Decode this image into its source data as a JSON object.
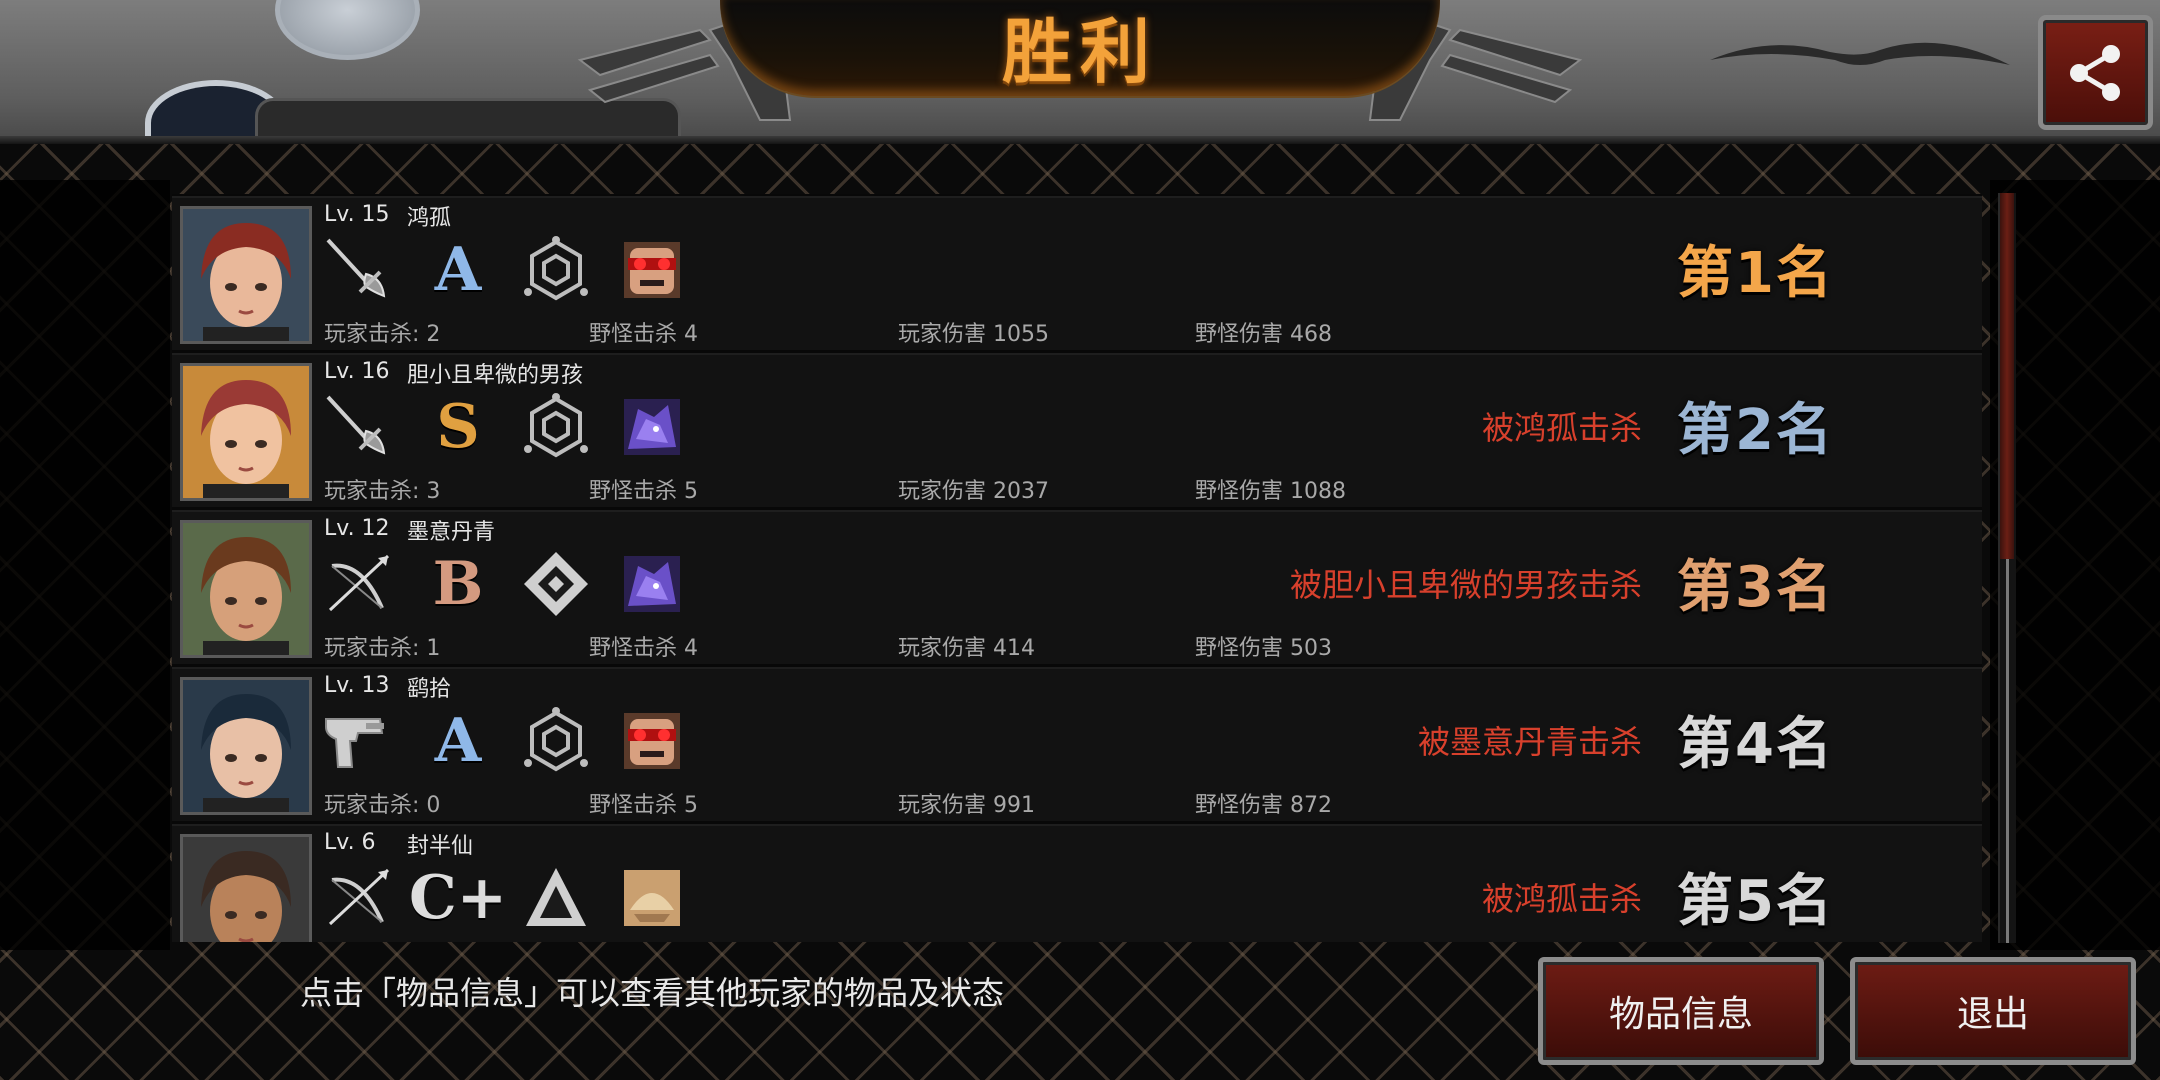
{
  "header": {
    "title": "胜利",
    "bg_color": "#6b6b6b",
    "title_color": "#f3a23a"
  },
  "rows": [
    {
      "level": "Lv. 15",
      "name": "鸿孤",
      "weapon_icon": "rapier-icon",
      "grade": "A",
      "grade_color": "#8fb8e8",
      "armor_icon": "hexagon-emblem-icon",
      "pet_icon": "red-goggles-face-icon",
      "player_kills": "玩家击杀: 2",
      "monster_kills": "野怪击杀 4",
      "player_damage": "玩家伤害 1055",
      "monster_damage": "野怪伤害 468",
      "killed_by": "",
      "rank": "第1名",
      "rank_color": "#f4a64a",
      "portrait_hair": "#8a2c22",
      "portrait_skin": "#e9b89a",
      "portrait_bg": "#3a4a5a"
    },
    {
      "level": "Lv. 16",
      "name": "胆小且卑微的男孩",
      "weapon_icon": "rapier-icon",
      "grade": "S",
      "grade_color": "#e0a040",
      "armor_icon": "hexagon-emblem-icon",
      "pet_icon": "purple-creature-icon",
      "player_kills": "玩家击杀: 3",
      "monster_kills": "野怪击杀 5",
      "player_damage": "玩家伤害 2037",
      "monster_damage": "野怪伤害 1088",
      "killed_by": "被鸿孤击杀",
      "rank": "第2名",
      "rank_color": "#9cb6d4",
      "portrait_hair": "#9a3a35",
      "portrait_skin": "#f0c2a0",
      "portrait_bg": "#c88a3a"
    },
    {
      "level": "Lv. 12",
      "name": "墨意丹青",
      "weapon_icon": "bow-icon",
      "grade": "B",
      "grade_color": "#d49a80",
      "armor_icon": "diamond-emblem-icon",
      "pet_icon": "purple-creature-icon",
      "player_kills": "玩家击杀: 1",
      "monster_kills": "野怪击杀 4",
      "player_damage": "玩家伤害 414",
      "monster_damage": "野怪伤害 503",
      "killed_by": "被胆小且卑微的男孩击杀",
      "rank": "第3名",
      "rank_color": "#e0a070",
      "portrait_hair": "#6a3a1e",
      "portrait_skin": "#d6a07a",
      "portrait_bg": "#5a6a4a"
    },
    {
      "level": "Lv. 13",
      "name": "鹞拾",
      "weapon_icon": "pistol-icon",
      "grade": "A",
      "grade_color": "#8fb8e8",
      "armor_icon": "hexagon-emblem-icon",
      "pet_icon": "red-goggles-face-icon",
      "player_kills": "玩家击杀: 0",
      "monster_kills": "野怪击杀 5",
      "player_damage": "玩家伤害 991",
      "monster_damage": "野怪伤害 872",
      "killed_by": "被墨意丹青击杀",
      "rank": "第4名",
      "rank_color": "#d8d8d8",
      "portrait_hair": "#1a2a3a",
      "portrait_skin": "#e8c0a6",
      "portrait_bg": "#2a3a4a"
    },
    {
      "level": "Lv. 6",
      "name": "封半仙",
      "weapon_icon": "bow-icon",
      "grade": "C+",
      "grade_color": "#dcdcdc",
      "armor_icon": "triangle-emblem-icon",
      "pet_icon": "tan-creature-icon",
      "player_kills": "",
      "monster_kills": "",
      "player_damage": "",
      "monster_damage": "",
      "killed_by": "被鸿孤击杀",
      "rank": "第5名",
      "rank_color": "#d8d8d8",
      "portrait_hair": "#3a2a22",
      "portrait_skin": "#b9825a",
      "portrait_bg": "#3a3a3a"
    }
  ],
  "footer": {
    "hint": "点击「物品信息」可以查看其他玩家的物品及状态",
    "item_info_label": "物品信息",
    "exit_label": "退出"
  }
}
